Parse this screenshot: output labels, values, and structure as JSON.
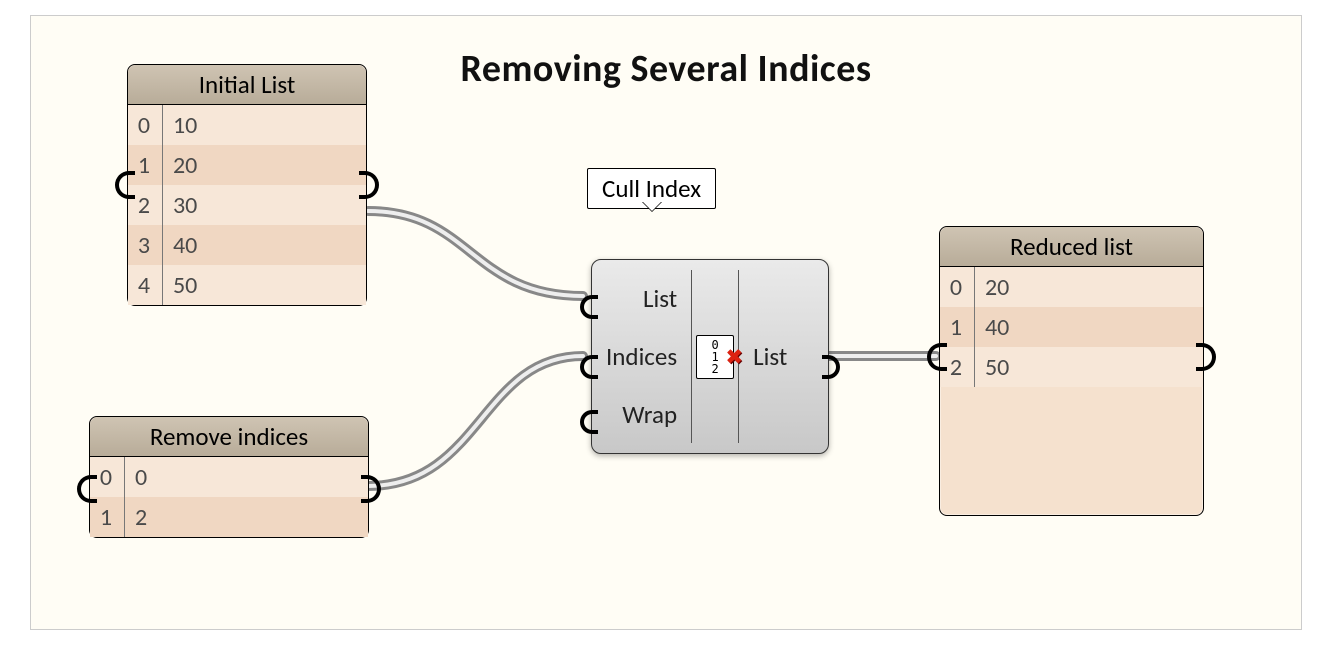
{
  "title": "Removing Several Indices",
  "panels": {
    "initial": {
      "title": "Initial List",
      "rows": [
        {
          "i": "0",
          "v": "10"
        },
        {
          "i": "1",
          "v": "20"
        },
        {
          "i": "2",
          "v": "30"
        },
        {
          "i": "3",
          "v": "40"
        },
        {
          "i": "4",
          "v": "50"
        }
      ]
    },
    "remove": {
      "title": "Remove indices",
      "rows": [
        {
          "i": "0",
          "v": "0"
        },
        {
          "i": "1",
          "v": "2"
        }
      ]
    },
    "reduced": {
      "title": "Reduced list",
      "rows": [
        {
          "i": "0",
          "v": "20"
        },
        {
          "i": "1",
          "v": "40"
        },
        {
          "i": "2",
          "v": "50"
        }
      ]
    }
  },
  "node": {
    "label": "Cull Index",
    "inputs": [
      "List",
      "Indices",
      "Wrap"
    ],
    "outputs": [
      "List"
    ],
    "icon_digits": [
      "0",
      "1",
      "2"
    ]
  }
}
